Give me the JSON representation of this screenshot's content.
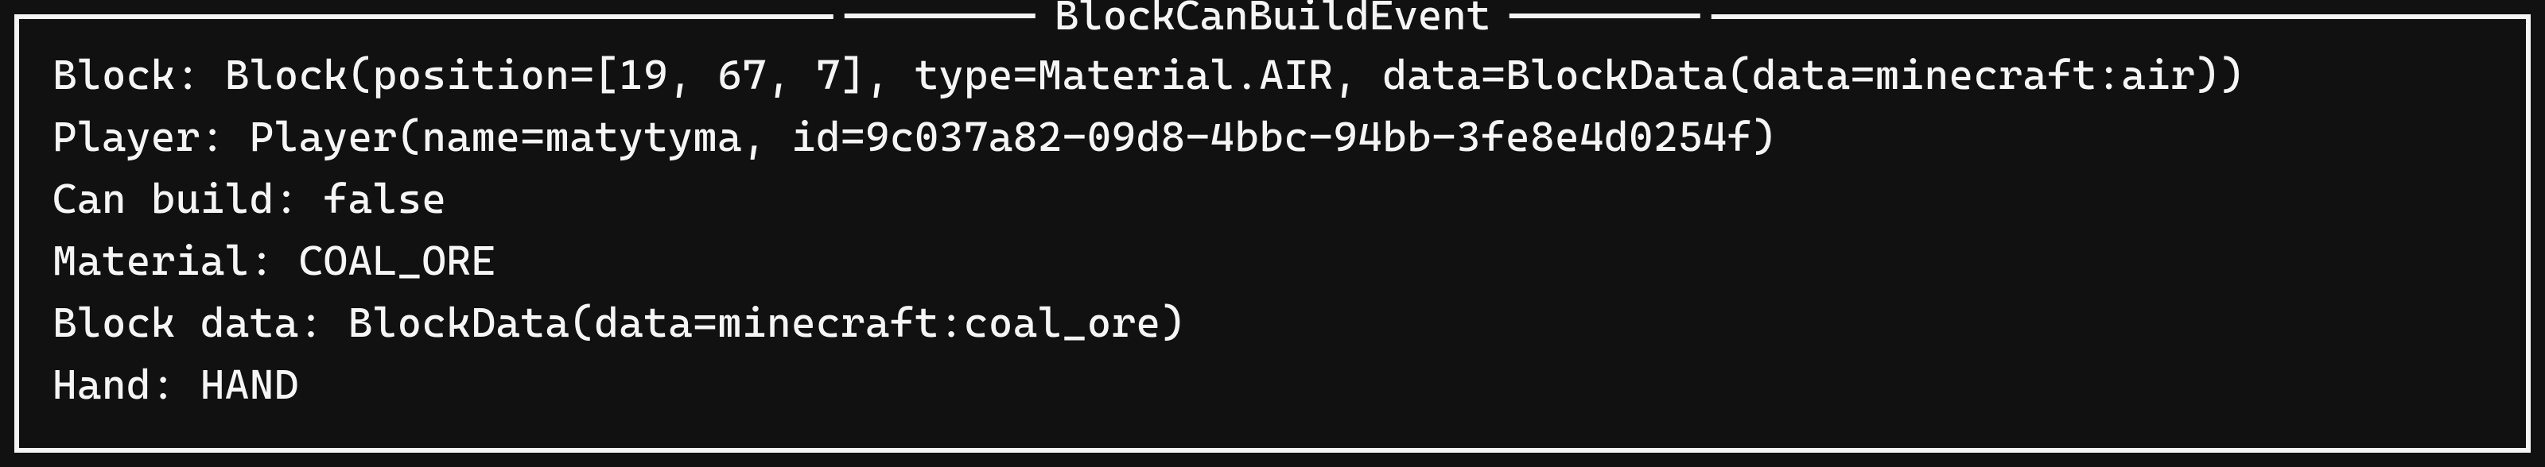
{
  "panel": {
    "title": "BlockCanBuildEvent",
    "rows": [
      {
        "label": "Block: ",
        "value": "Block(position=[19, 67, 7], type=Material.AIR, data=BlockData(data=minecraft:air))"
      },
      {
        "label": "Player: ",
        "value": "Player(name=matytyma, id=9c037a82-09d8-4bbc-94bb-3fe8e4d0254f)"
      },
      {
        "label": "Can build: ",
        "value": "false"
      },
      {
        "label": "Material: ",
        "value": "COAL_ORE"
      },
      {
        "label": "Block data: ",
        "value": "BlockData(data=minecraft:coal_ore)"
      },
      {
        "label": "Hand: ",
        "value": "HAND"
      }
    ]
  }
}
